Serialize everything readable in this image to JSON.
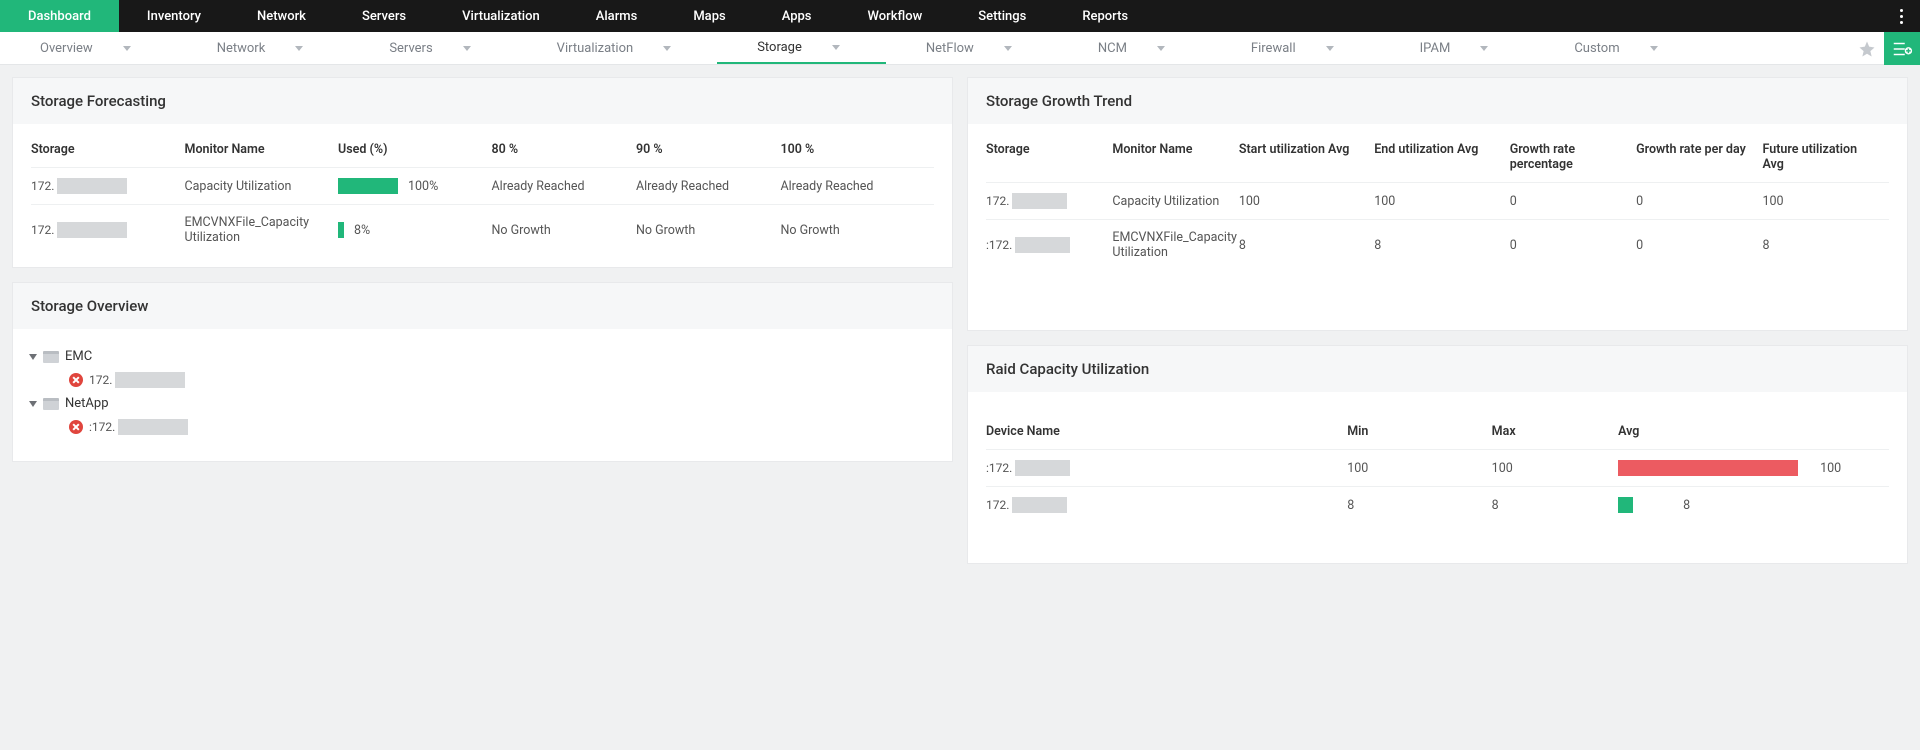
{
  "top_nav": {
    "items": [
      "Dashboard",
      "Inventory",
      "Network",
      "Servers",
      "Virtualization",
      "Alarms",
      "Maps",
      "Apps",
      "Workflow",
      "Settings",
      "Reports"
    ],
    "active_index": 0
  },
  "sub_nav": {
    "items": [
      "Overview",
      "Network",
      "Servers",
      "Virtualization",
      "Storage",
      "NetFlow",
      "NCM",
      "Firewall",
      "IPAM",
      "Custom"
    ],
    "active_index": 4
  },
  "panels": {
    "forecasting": {
      "title": "Storage Forecasting",
      "columns": [
        "Storage",
        "Monitor Name",
        "Used (%)",
        "80 %",
        "90 %",
        "100 %"
      ],
      "rows": [
        {
          "storage_prefix": "172.",
          "monitor": "Capacity Utilization",
          "used_pct": 100,
          "used_label": "100%",
          "c80": "Already Reached",
          "c90": "Already Reached",
          "c100": "Already Reached"
        },
        {
          "storage_prefix": "172.",
          "monitor": "EMCVNXFile_Capacity Utilization",
          "used_pct": 8,
          "used_label": "8%",
          "c80": "No Growth",
          "c90": "No Growth",
          "c100": "No Growth"
        }
      ]
    },
    "overview": {
      "title": "Storage Overview",
      "tree": [
        {
          "label": "EMC",
          "children": [
            {
              "prefix": "172."
            }
          ]
        },
        {
          "label": "NetApp",
          "children": [
            {
              "prefix": ":172."
            }
          ]
        }
      ]
    },
    "growth": {
      "title": "Storage Growth Trend",
      "columns": [
        "Storage",
        "Monitor Name",
        "Start utilization Avg",
        "End utilization Avg",
        "Growth rate percentage",
        "Growth rate per day",
        "Future utilization Avg"
      ],
      "rows": [
        {
          "storage_prefix": "172.",
          "monitor": "Capacity Utilization",
          "start": "100",
          "end": "100",
          "pct": "0",
          "perday": "0",
          "future": "100"
        },
        {
          "storage_prefix": ":172.",
          "monitor": "EMCVNXFile_Capacity Utilization",
          "start": "8",
          "end": "8",
          "pct": "0",
          "perday": "0",
          "future": "8"
        }
      ]
    },
    "raid": {
      "title": "Raid Capacity Utilization",
      "columns": [
        "Device Name",
        "Min",
        "Max",
        "Avg"
      ],
      "rows": [
        {
          "device_prefix": ":172.",
          "min": "100",
          "max": "100",
          "avg": "100",
          "bar_pct": 100,
          "color": "red"
        },
        {
          "device_prefix": "172.",
          "min": "8",
          "max": "8",
          "avg": "8",
          "bar_pct": 8,
          "color": "green"
        }
      ]
    }
  },
  "colors": {
    "green": "#21b77a",
    "red": "#ec5b61"
  }
}
